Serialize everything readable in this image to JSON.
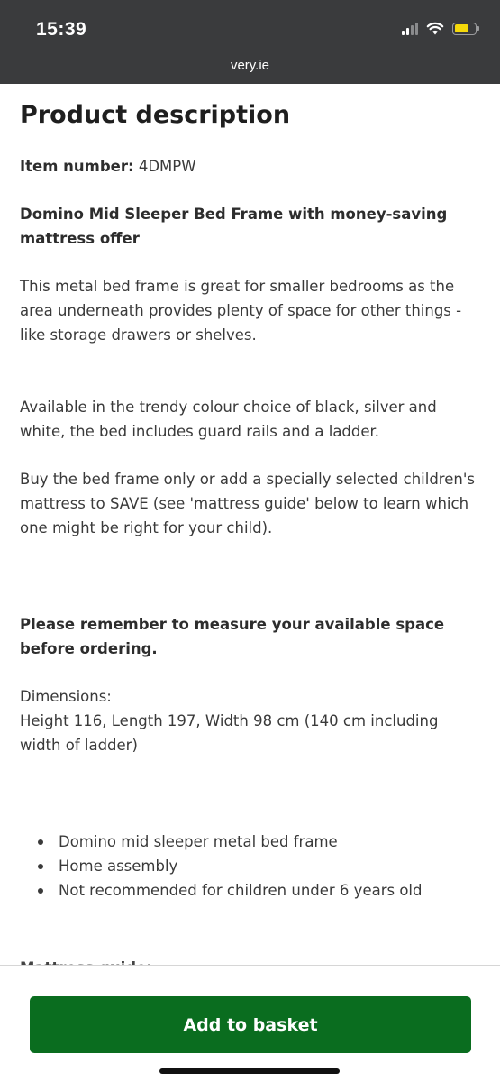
{
  "status_bar": {
    "time": "15:39",
    "url": "very.ie",
    "icons": [
      "signal-icon",
      "wifi-icon",
      "battery-icon"
    ]
  },
  "product": {
    "heading": "Product description",
    "item_number_label": "Item number:",
    "item_number_value": "4DMPW",
    "name": "Domino Mid Sleeper Bed Frame with money-saving mattress offer",
    "paragraphs": [
      "This metal bed frame is great for smaller bedrooms as the area underneath provides plenty of space for other things - like storage drawers or shelves.",
      "Available in the trendy colour choice of black, silver and white, the bed includes guard rails and a ladder.",
      "Buy the bed frame only or add a specially selected children's mattress to SAVE (see 'mattress guide' below to learn which one might be right for your child)."
    ],
    "measure_note": "Please remember to measure your available space before ordering.",
    "dimensions_label": "Dimensions:",
    "dimensions_value": "Height 116, Length 197, Width 98 cm (140 cm including width of ladder)",
    "bullets": [
      "Domino mid sleeper metal bed frame",
      "Home assembly",
      "Not recommended for children under 6 years old"
    ],
    "next_section_peek": "Mattress guide:"
  },
  "actions": {
    "add_to_basket_label": "Add to basket"
  },
  "colors": {
    "status_bar_bg": "#3a3b3d",
    "primary_green": "#0a6d1f",
    "battery_yellow": "#f5d90a"
  }
}
